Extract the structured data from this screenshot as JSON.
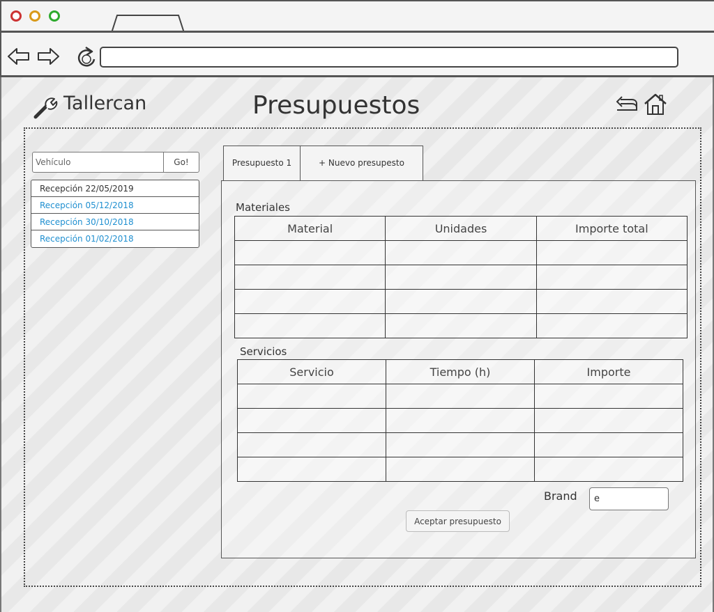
{
  "app": {
    "name": "Tallercan",
    "page_title": "Presupuestos"
  },
  "search": {
    "placeholder": "Vehículo",
    "button_label": "Go!"
  },
  "receptions": [
    "Recepción 22/05/2019",
    "Recepción 05/12/2018",
    "Recepción  30/10/2018",
    "Recepción 01/02/2018"
  ],
  "tabs": [
    "Presupuesto 1",
    "+ Nuevo presupesto"
  ],
  "materiales": {
    "label": "Materiales",
    "columns": [
      "Material",
      "Unidades",
      "Importe total"
    ],
    "rows": [
      [
        "",
        "",
        ""
      ],
      [
        "",
        "",
        ""
      ],
      [
        "",
        "",
        ""
      ],
      [
        "",
        "",
        ""
      ]
    ]
  },
  "servicios": {
    "label": "Servicios",
    "columns": [
      "Servicio",
      "Tiempo (h)",
      "Importe"
    ],
    "rows": [
      [
        "",
        "",
        ""
      ],
      [
        "",
        "",
        ""
      ],
      [
        "",
        "",
        ""
      ],
      [
        "",
        "",
        ""
      ]
    ]
  },
  "brand": {
    "label": "Brand",
    "value": "e"
  },
  "accept_button": "Aceptar presupuesto",
  "colors": {
    "link": "#1f8fd0",
    "light_red": "#cc3333",
    "light_yellow": "#d99a1a",
    "light_green": "#2eaa2e"
  },
  "icons": [
    "wrench-icon",
    "undo-icon",
    "home-icon",
    "back-arrow-icon",
    "forward-arrow-icon",
    "reload-icon"
  ]
}
